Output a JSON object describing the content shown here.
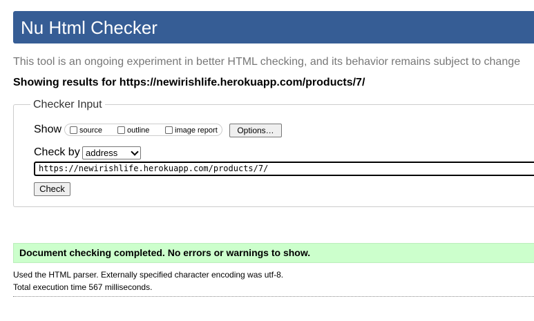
{
  "header": {
    "title": "Nu Html Checker",
    "color": "#365d95"
  },
  "tagline": "This tool is an ongoing experiment in better HTML checking, and its behavior remains subject to change",
  "results_for": "Showing results for https://newirishlife.herokuapp.com/products/7/",
  "checker_input": {
    "legend": "Checker Input",
    "show_label": "Show",
    "options": {
      "source": "source",
      "outline": "outline",
      "image_report": "image report"
    },
    "options_button": "Options…",
    "check_by_label": "Check by",
    "check_by_value": "address",
    "url_value": "https://newirishlife.herokuapp.com/products/7/",
    "check_button": "Check"
  },
  "result": {
    "message": "Document checking completed. No errors or warnings to show.",
    "color": "#ccffcc"
  },
  "details": {
    "parser": "Used the HTML parser. Externally specified character encoding was utf-8.",
    "time": "Total execution time 567 milliseconds."
  }
}
